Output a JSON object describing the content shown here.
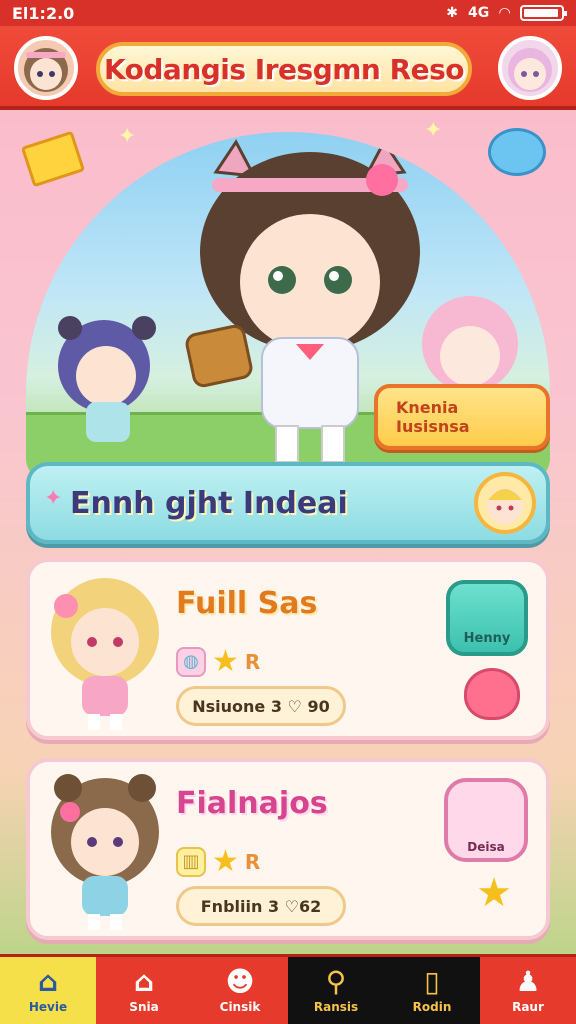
{
  "status_bar": {
    "time": "El1:2.0",
    "signal": "4G"
  },
  "header": {
    "title": "Kodangis Iresgmn Reso"
  },
  "hero": {
    "badge": "Knenia Iusisnsa"
  },
  "event": {
    "title": "Ennh gjht Indeai"
  },
  "cards": [
    {
      "name": "Fuill Sas",
      "rating": "R",
      "pill": "Nsiuone 3 ♡ 90",
      "side_label": "Henny"
    },
    {
      "name": "Fialnajos",
      "rating": "R",
      "pill": "Fnbliin 3 ♡62",
      "side_label": "Deisa"
    }
  ],
  "nav": [
    {
      "label": "Hevie",
      "icon": "home-icon"
    },
    {
      "label": "Snia",
      "icon": "shop-icon"
    },
    {
      "label": "Cinsik",
      "icon": "character-icon"
    },
    {
      "label": "Ransis",
      "icon": "search-icon"
    },
    {
      "label": "Rodin",
      "icon": "book-icon"
    },
    {
      "label": "Raur",
      "icon": "profile-icon"
    }
  ],
  "colors": {
    "header": "#e53a2c",
    "accent": "#f6c24a",
    "event": "#8ddce2"
  }
}
